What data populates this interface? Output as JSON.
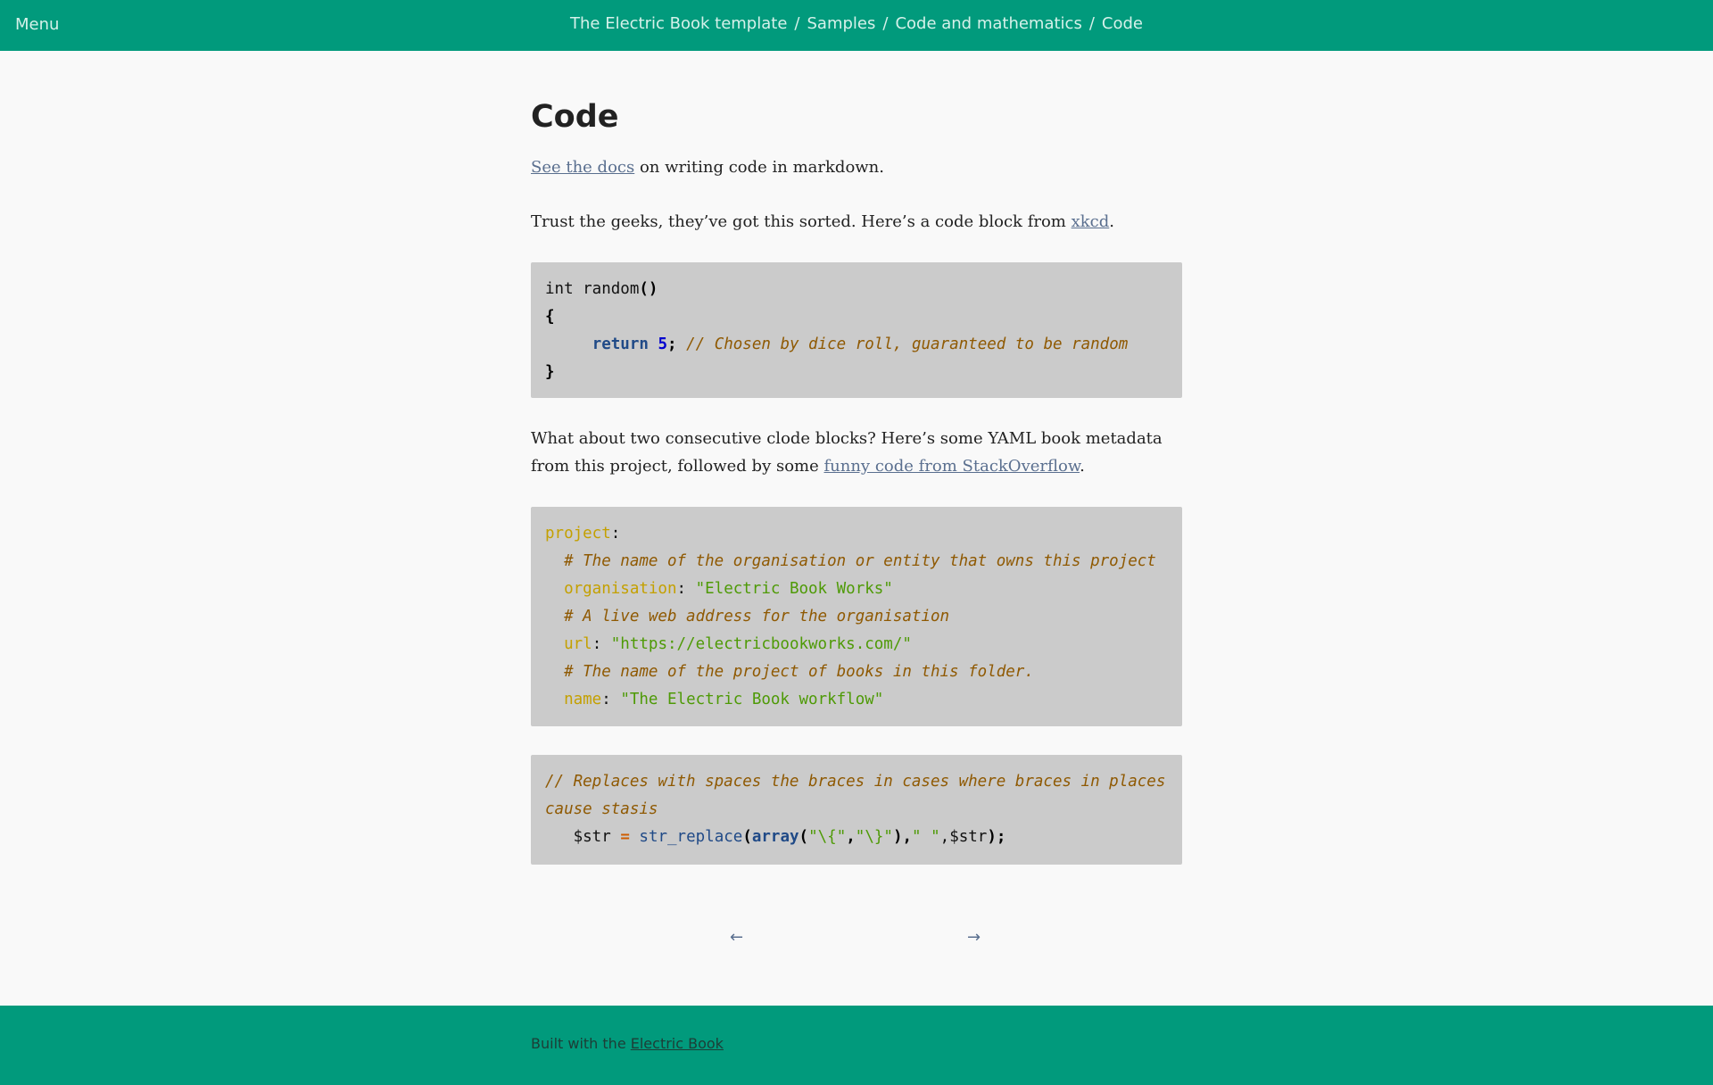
{
  "header": {
    "menu_label": "Menu",
    "breadcrumbs": [
      "The Electric Book template",
      "Samples",
      "Code and mathematics",
      "Code"
    ],
    "separator": "/"
  },
  "page": {
    "title": "Code",
    "para1_link": "See the docs",
    "para1_rest": " on writing code in markdown.",
    "para2_text": "Trust the geeks, they’ve got this sorted. Here’s a code block from ",
    "para2_link": "xkcd",
    "para2_end": ".",
    "para3_text": "What about two consecutive clode blocks? Here’s some YAML book metadata from this project, followed by some ",
    "para3_link": "funny code from StackOverflow",
    "para3_end": "."
  },
  "code1": {
    "l1_a": "int random",
    "l1_b": "()",
    "l2": "{",
    "l3_indent": "     ",
    "l3_kw": "return",
    "l3_num": "5",
    "l3_semi": ";",
    "l3_comment": "// Chosen by dice roll, guaranteed to be random",
    "l4": "}"
  },
  "code2": {
    "project_key": "project",
    "comment1": "# The name of the organisation or entity that owns this project",
    "org_key": "organisation",
    "org_val": "\"Electric Book Works\"",
    "comment2": "# A live web address for the organisation",
    "url_key": "url",
    "url_val": "\"https://electricbookworks.com/\"",
    "comment3": "# The name of the project of books in this folder.",
    "name_key": "name",
    "name_val": "\"The Electric Book workflow\""
  },
  "code3": {
    "comment": "// Replaces with spaces the braces in cases where braces in places cause stasis",
    "var": "$str",
    "eq": "=",
    "fn": "str_replace",
    "kw": "array",
    "s1": "\"\\{\"",
    "s2": "\"\\}\"",
    "s3": "\" \"",
    "var2": "$str"
  },
  "pager": {
    "prev": "←",
    "next": "→"
  },
  "footer": {
    "text": "Built with the ",
    "link": "Electric Book"
  }
}
